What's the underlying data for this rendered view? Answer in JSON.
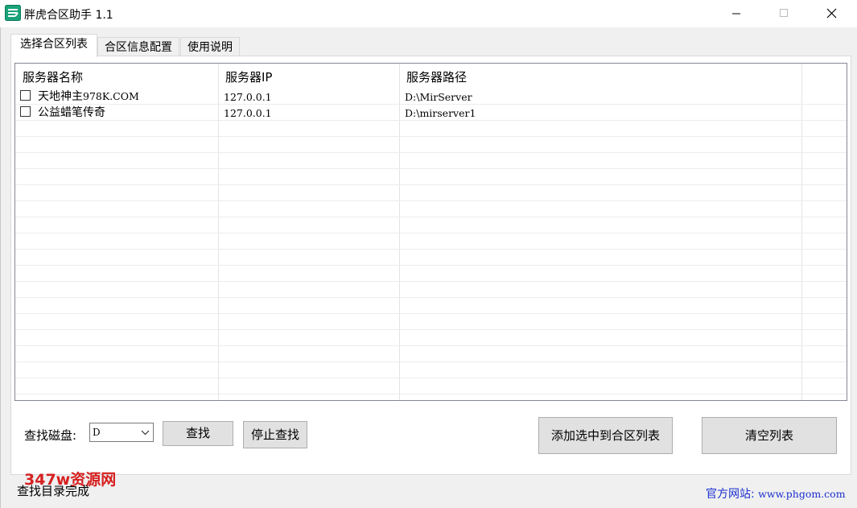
{
  "window": {
    "title": "胖虎合区助手 1.1",
    "icon": "app-logo-icon",
    "controls": [
      "minimize-icon",
      "maximize-icon",
      "close-icon"
    ]
  },
  "tabs": [
    {
      "label": "选择合区列表",
      "active": true
    },
    {
      "label": "合区信息配置",
      "active": false
    },
    {
      "label": "使用说明",
      "active": false
    }
  ],
  "list": {
    "headers": {
      "name": "服务器名称",
      "ip": "服务器IP",
      "path": "服务器路径"
    },
    "rows": [
      {
        "checked": false,
        "name_cn": "天地神主",
        "name_en": "978K.COM",
        "ip": "127.0.0.1",
        "path": "D:\\MirServer"
      },
      {
        "checked": false,
        "name_cn": "公益蜡笔传奇",
        "name_en": "",
        "ip": "127.0.0.1",
        "path": "D:\\mirserver1"
      }
    ]
  },
  "search": {
    "disk_label": "查找磁盘:",
    "disk_value": "D",
    "find_button": "查找",
    "stop_button": "停止查找"
  },
  "actions": {
    "add_button": "添加选中到合区列表",
    "clear_button": "清空列表"
  },
  "statusbar": {
    "status_text": "查找目录完成",
    "watermark": "347w资源网",
    "website_label": "官方网站:",
    "website_url": "www.phgom.com"
  },
  "colors": {
    "watermark": "#d62020",
    "website": "#1a2fd0",
    "background": "#f0f0f0"
  }
}
